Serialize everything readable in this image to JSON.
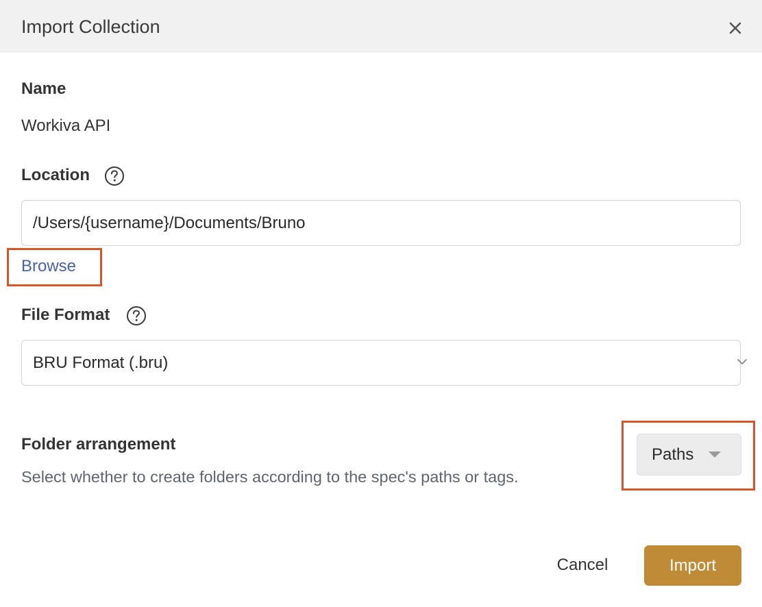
{
  "modal": {
    "title": "Import Collection",
    "close_icon": "close-icon"
  },
  "name_field": {
    "label": "Name",
    "value": "Workiva API"
  },
  "location_field": {
    "label": "Location",
    "help_icon": "question-circle-icon",
    "value": "/Users/{username}/Documents/Bruno",
    "browse_label": "Browse"
  },
  "file_format_field": {
    "label": "File Format",
    "help_icon": "question-circle-icon",
    "selected": "BRU Format (.bru)",
    "chevron_icon": "chevron-down-icon"
  },
  "folder_arrangement": {
    "label": "Folder arrangement",
    "description": "Select whether to create folders according to the spec's paths or tags.",
    "selected": "Paths",
    "caret_icon": "caret-down-icon"
  },
  "footer": {
    "cancel_label": "Cancel",
    "import_label": "Import"
  },
  "colors": {
    "header_bg": "#f1f1f1",
    "link": "#4a62a8",
    "primary_button": "#bf8b36",
    "highlight_border": "#d4572a"
  }
}
